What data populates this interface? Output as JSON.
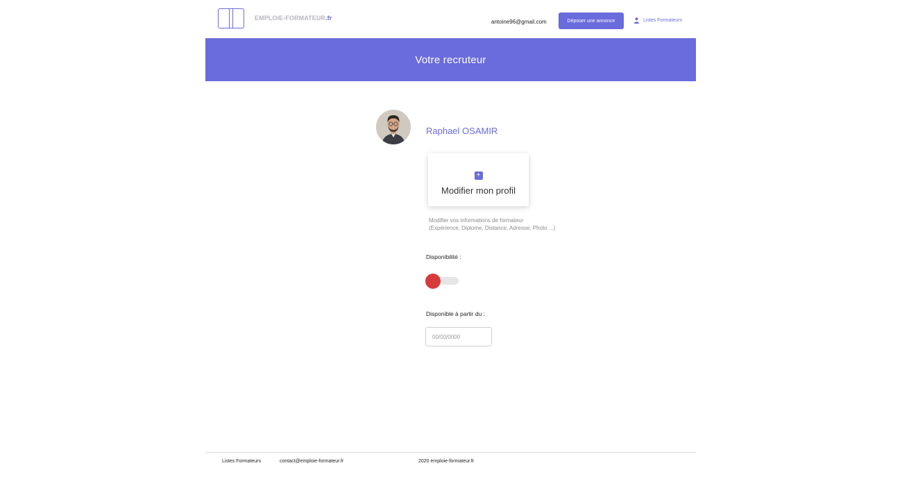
{
  "header": {
    "logo_text": "EMPLOIE-FORMATEUR",
    "logo_tld": ".fr",
    "user_email": "antoine96@gmail.com",
    "post_button_label": "Déposer une annonce",
    "nav_trainers_label": "Listes Formateurs",
    "nav_trainers_icon": "user-icon"
  },
  "banner": {
    "title": "Votre recruteur"
  },
  "profile": {
    "name": "Raphael OSAMIR",
    "edit_card": {
      "icon": "plus-icon",
      "label": "Modifier mon profil"
    },
    "edit_description_line1": "Modifier vos informations de formateur",
    "edit_description_line2": "(Expérience, Diplome, Distance, Adresse, Photo ...)"
  },
  "availability": {
    "label": "Disponibilité :",
    "enabled": false
  },
  "available_from": {
    "label": "Disponible à partir du :",
    "placeholder": "00/00/0000",
    "value": ""
  },
  "footer": {
    "trainers_link": "Listes Formateurs",
    "contact_email": "contact@emploie-formateur.fr",
    "copyright": "2020 emploie-formateur.fr"
  },
  "colors": {
    "accent": "#6a6bdc",
    "toggle_off": "#d63b3b",
    "logo_text": "#b7b7bf"
  }
}
